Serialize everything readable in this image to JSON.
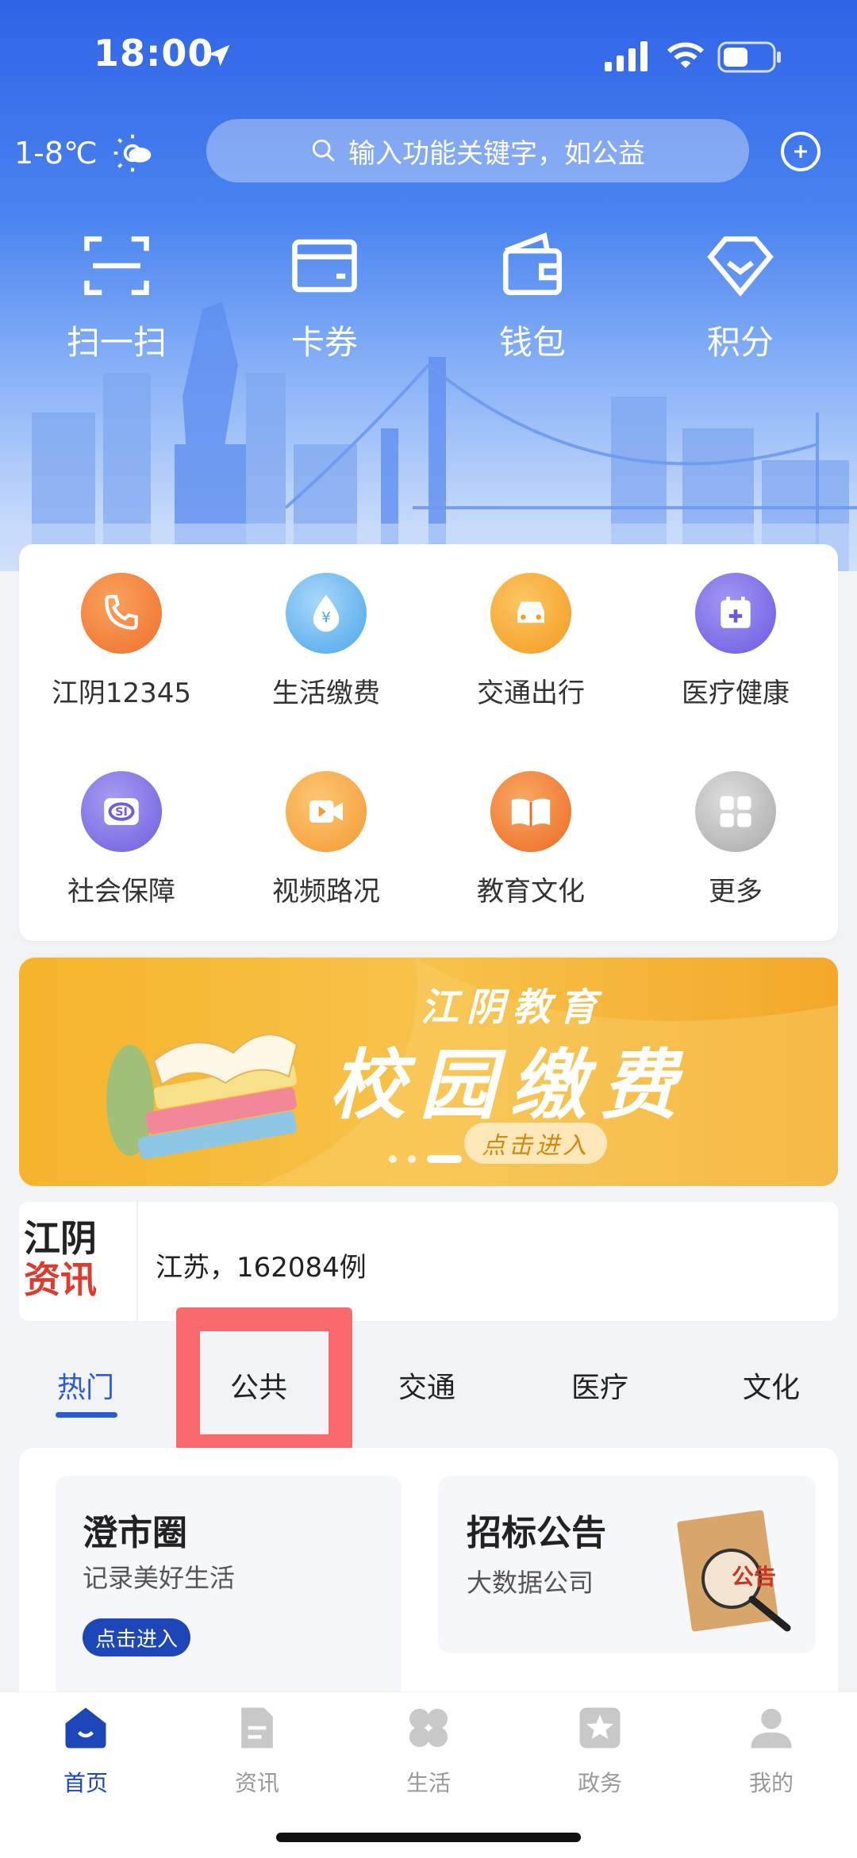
{
  "status_bar": {
    "time": "18:00"
  },
  "header": {
    "weather": "1-8℃",
    "search_placeholder": "输入功能关键字，如公益"
  },
  "quick_actions": [
    {
      "label": "扫一扫",
      "icon": "scan-icon"
    },
    {
      "label": "卡券",
      "icon": "card-icon"
    },
    {
      "label": "钱包",
      "icon": "wallet-icon"
    },
    {
      "label": "积分",
      "icon": "diamond-icon"
    }
  ],
  "services": [
    {
      "label": "江阴12345",
      "icon": "phone-icon",
      "color": "#f28a3a"
    },
    {
      "label": "生活缴费",
      "icon": "water-drop-icon",
      "color": "#4aa5ea"
    },
    {
      "label": "交通出行",
      "icon": "car-icon",
      "color": "#f6a52b"
    },
    {
      "label": "医疗健康",
      "icon": "calendar-plus-icon",
      "color": "#7b68e6"
    },
    {
      "label": "社会保障",
      "icon": "social-security-icon",
      "color": "#7b6fe3"
    },
    {
      "label": "视频路况",
      "icon": "video-icon",
      "color": "#f7a641"
    },
    {
      "label": "教育文化",
      "icon": "book-icon",
      "color": "#f07b2f"
    },
    {
      "label": "更多",
      "icon": "grid-icon",
      "color": "#b5b5b5"
    }
  ],
  "banner": {
    "subtitle": "江阴教育",
    "title": "校园缴费",
    "button": "点击进入"
  },
  "news": {
    "logo_line1": "江阴",
    "logo_line2": "资讯",
    "text": "江苏，162084例"
  },
  "tabs": [
    "热门",
    "公共",
    "交通",
    "医疗",
    "文化"
  ],
  "feature_cards": [
    {
      "title": "澄市圈",
      "subtitle": "记录美好生活",
      "button": "点击进入"
    },
    {
      "title": "招标公告",
      "subtitle": "大数据公司",
      "stamp": "公告"
    }
  ],
  "bottom_nav": [
    {
      "label": "首页",
      "icon": "home-icon",
      "active": true
    },
    {
      "label": "资讯",
      "icon": "document-icon"
    },
    {
      "label": "生活",
      "icon": "clover-icon"
    },
    {
      "label": "政务",
      "icon": "star-badge-icon"
    },
    {
      "label": "我的",
      "icon": "user-icon"
    }
  ],
  "colors": {
    "brand": "#2a5bd7",
    "highlight": "#f84646"
  }
}
